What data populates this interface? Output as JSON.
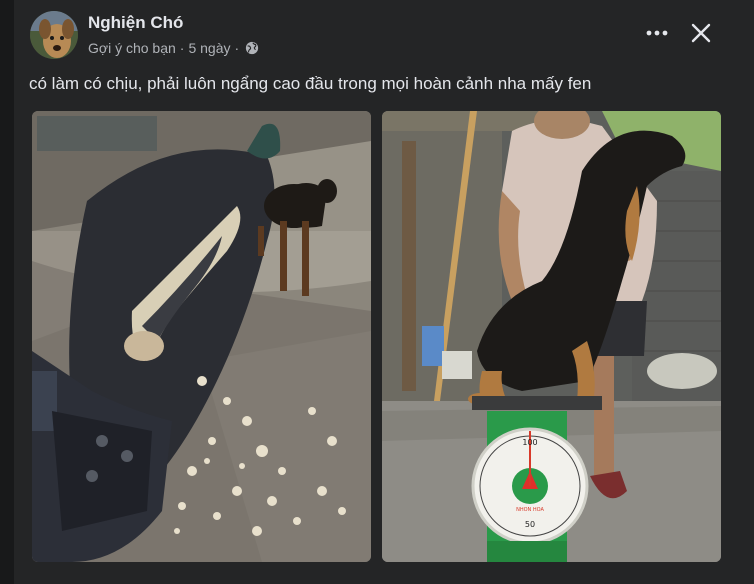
{
  "post": {
    "author": "Nghiện Chó",
    "meta_suggest": "Gợi ý cho bạn",
    "meta_dot": "·",
    "meta_time": "5 ngày",
    "meta_dot2": "·",
    "privacy_icon": "globe-icon",
    "caption": "có làm có chịu, phải luôn ngẩng cao đầu trong mọi hoàn cảnh nha mấy fen",
    "more_icon": "more-horizontal-icon",
    "close_icon": "close-icon"
  },
  "photos": [
    {
      "subject": "damaged-scooter-seat-with-dog"
    },
    {
      "subject": "woman-holding-dog-on-scale"
    }
  ],
  "scale": {
    "brand": "NHON HOA"
  },
  "colors": {
    "background": "#18191a",
    "card": "#242526",
    "primary_text": "#e4e6eb",
    "secondary_text": "#b0b3b8"
  }
}
